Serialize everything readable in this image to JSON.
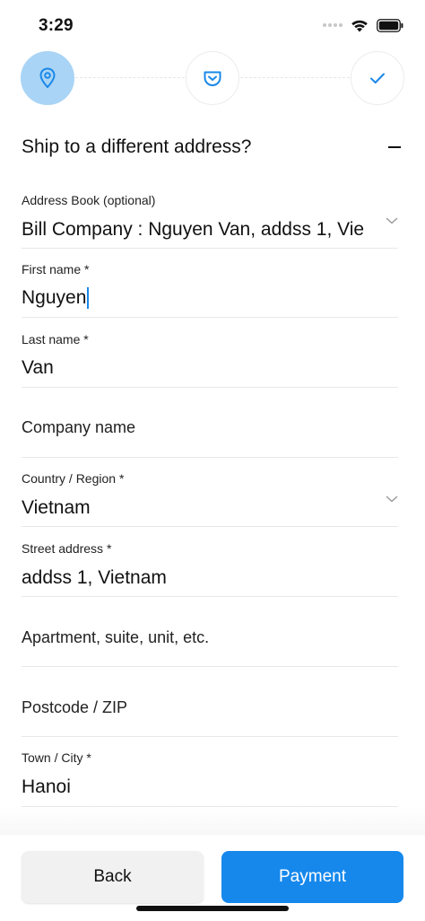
{
  "status_bar": {
    "time": "3:29"
  },
  "stepper": {
    "steps": [
      {
        "icon": "location-pin-icon",
        "state": "active"
      },
      {
        "icon": "pocket-icon",
        "state": "pending"
      },
      {
        "icon": "checkmark-icon",
        "state": "pending"
      }
    ],
    "active_color": "#a9d4f5",
    "accent_color": "#1a88e8"
  },
  "section": {
    "title": "Ship to a different address?"
  },
  "form": {
    "address_book": {
      "label": "Address Book (optional)",
      "value": "Bill Company : Nguyen Van, addss 1, Vie"
    },
    "first_name": {
      "label": "First name *",
      "value": "Nguyen"
    },
    "last_name": {
      "label": "Last name *",
      "value": "Van"
    },
    "company": {
      "placeholder": "Company name"
    },
    "country": {
      "label": "Country / Region *",
      "value": "Vietnam"
    },
    "street": {
      "label": "Street address *",
      "value": "addss 1, Vietnam"
    },
    "apartment": {
      "placeholder": "Apartment, suite, unit, etc."
    },
    "postcode": {
      "placeholder": "Postcode / ZIP"
    },
    "city": {
      "label": "Town / City *",
      "value": "Hanoi"
    }
  },
  "actions": {
    "back_label": "Back",
    "payment_label": "Payment",
    "primary_color": "#1688ec"
  }
}
